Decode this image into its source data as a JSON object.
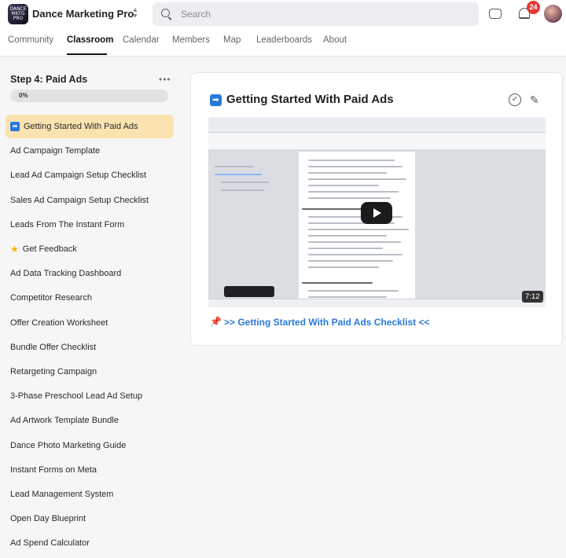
{
  "header": {
    "app_title": "Dance Marketing Pro",
    "logo_text": "DANCE MKTG PRO",
    "search_placeholder": "Search",
    "notification_count": "24",
    "icons": [
      "switch-icon",
      "search-icon",
      "chat-icon",
      "bell-icon",
      "avatar"
    ]
  },
  "nav": {
    "tabs": [
      {
        "label": "Community",
        "active": false
      },
      {
        "label": "Classroom",
        "active": true
      },
      {
        "label": "Calendar",
        "active": false
      },
      {
        "label": "Members",
        "active": false
      },
      {
        "label": "Map",
        "active": false
      },
      {
        "label": "Leaderboards",
        "active": false
      },
      {
        "label": "About",
        "active": false
      }
    ]
  },
  "sidebar": {
    "step_title": "Step 4: Paid Ads",
    "progress_label": "0%",
    "progress_fraction": 0,
    "lessons": [
      {
        "label": "Getting Started With Paid Ads",
        "icon": "arrow-right-icon",
        "active": true
      },
      {
        "label": "Ad Campaign Template"
      },
      {
        "label": "Lead Ad Campaign Setup Checklist"
      },
      {
        "label": "Sales Ad Campaign Setup Checklist"
      },
      {
        "label": "Leads From The Instant Form"
      },
      {
        "label": "Get Feedback",
        "icon": "star-icon"
      },
      {
        "label": "Ad Data Tracking Dashboard"
      },
      {
        "label": "Competitor Research"
      },
      {
        "label": "Offer Creation Worksheet"
      },
      {
        "label": "Bundle Offer Checklist"
      },
      {
        "label": "Retargeting Campaign"
      },
      {
        "label": "3-Phase Preschool Lead Ad Setup"
      },
      {
        "label": "Ad Artwork Template Bundle"
      },
      {
        "label": "Dance Photo Marketing Guide"
      },
      {
        "label": "Instant Forms on Meta"
      },
      {
        "label": "Lead Management System"
      },
      {
        "label": "Open Day Blueprint"
      },
      {
        "label": "Ad Spend Calculator"
      }
    ]
  },
  "main": {
    "lesson_title": "Getting Started With Paid Ads",
    "lesson_icon": "arrow-right-icon",
    "video_duration": "7:12",
    "checklist_link": ">> Getting Started With Paid Ads Checklist <<",
    "colors": {
      "accent": "#2a79d9",
      "active_lesson_bg": "#fbe3b0",
      "badge": "#e53935"
    }
  }
}
